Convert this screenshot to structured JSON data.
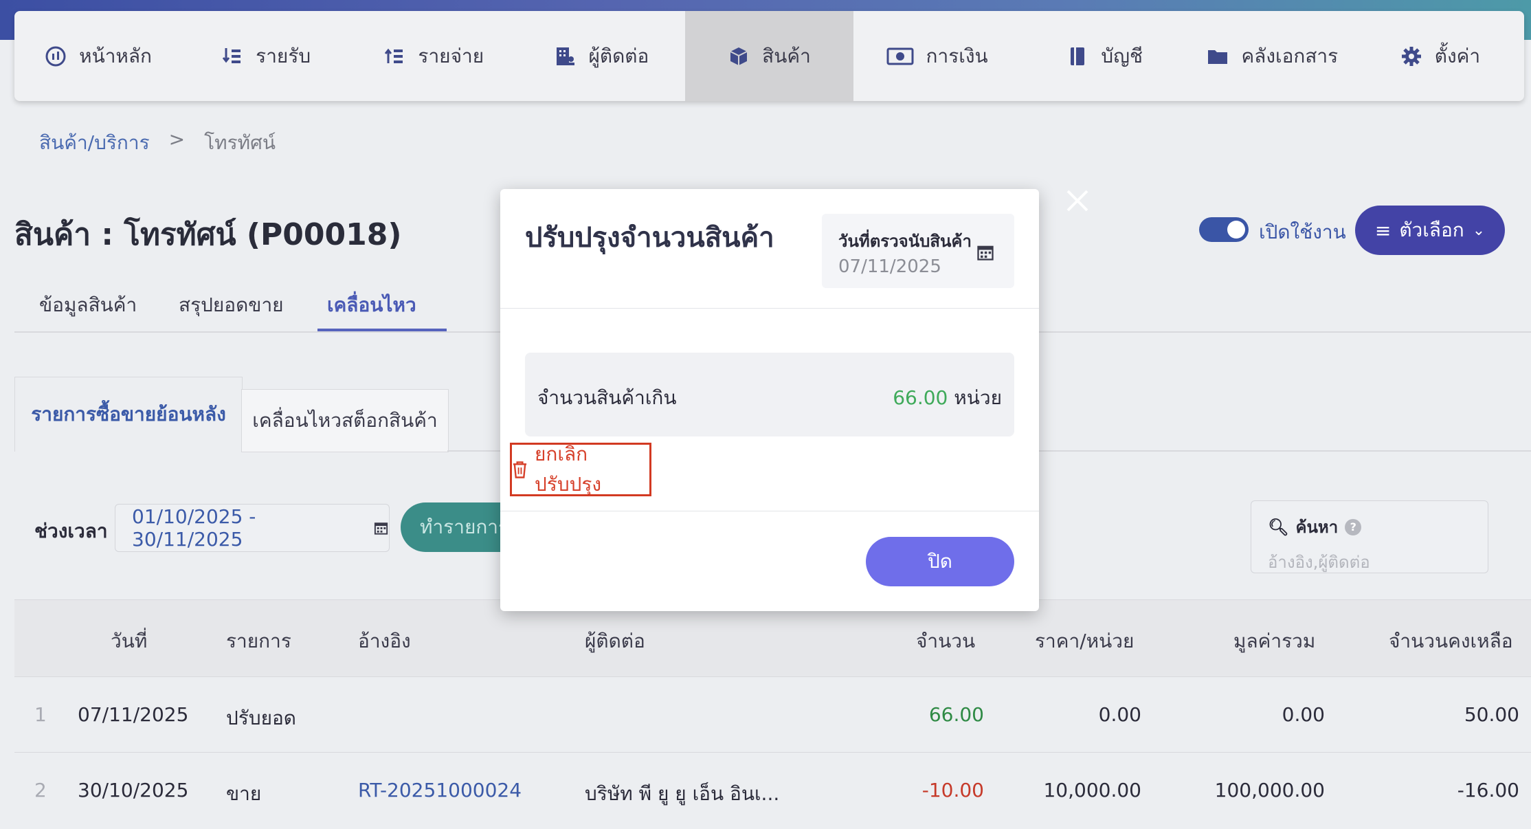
{
  "nav": [
    {
      "label": "หน้าหลัก",
      "icon": "dashboard-icon"
    },
    {
      "label": "รายรับ",
      "icon": "income-icon"
    },
    {
      "label": "รายจ่าย",
      "icon": "expense-icon"
    },
    {
      "label": "ผู้ติดต่อ",
      "icon": "contacts-icon"
    },
    {
      "label": "สินค้า",
      "icon": "product-box-icon",
      "active": true
    },
    {
      "label": "การเงิน",
      "icon": "money-icon"
    },
    {
      "label": "บัญชี",
      "icon": "ledger-icon"
    },
    {
      "label": "คลังเอกสาร",
      "icon": "folder-icon"
    },
    {
      "label": "ตั้งค่า",
      "icon": "gear-icon"
    }
  ],
  "breadcrumb": {
    "parent": "สินค้า/บริการ",
    "separator": ">",
    "current": "โทรทัศน์"
  },
  "page": {
    "title": "สินค้า : โทรทัศน์ (P00018)",
    "toggle_label": "เปิดใช้งาน",
    "options_label": "ตัวเลือก"
  },
  "tabs": [
    "ข้อมูลสินค้า",
    "สรุปยอดขาย",
    "เคลื่อนไหว"
  ],
  "subtabs": [
    "รายการซื้อขายย้อนหลัง",
    "เคลื่อนไหวสต็อกสินค้า"
  ],
  "filter": {
    "label": "ช่วงเวลา",
    "range": "01/10/2025 - 30/11/2025",
    "action_label": "ทำรายการ",
    "search_title": "ค้นหา",
    "search_placeholder": "อ้างอิง,ผู้ติดต่อ"
  },
  "table": {
    "headers": [
      "วันที่",
      "รายการ",
      "อ้างอิง",
      "ผู้ติดต่อ",
      "จำนวน",
      "ราคา/หน่วย",
      "มูลค่ารวม",
      "จำนวนคงเหลือ"
    ],
    "rows": [
      {
        "idx": "1",
        "date": "07/11/2025",
        "type": "ปรับยอด",
        "ref": "",
        "contact": "",
        "qty": "66.00",
        "price": "0.00",
        "total": "0.00",
        "balance": "50.00"
      },
      {
        "idx": "2",
        "date": "30/10/2025",
        "type": "ขาย",
        "ref": "RT-20251000024",
        "contact": "บริษัท พี ยู ยู เอ็น อินเ...",
        "qty": "-10.00",
        "price": "10,000.00",
        "total": "100,000.00",
        "balance": "-16.00"
      }
    ]
  },
  "modal": {
    "title": "ปรับปรุงจำนวนสินค้า",
    "date_label": "วันที่ตรวจนับสินค้า",
    "date_value": "07/11/2025",
    "qty_label": "จำนวนสินค้าเกิน",
    "qty_value": "66.00",
    "qty_unit": "หน่วย",
    "cancel_label": "ยกเลิกปรับปรุง",
    "close_label": "ปิด"
  }
}
